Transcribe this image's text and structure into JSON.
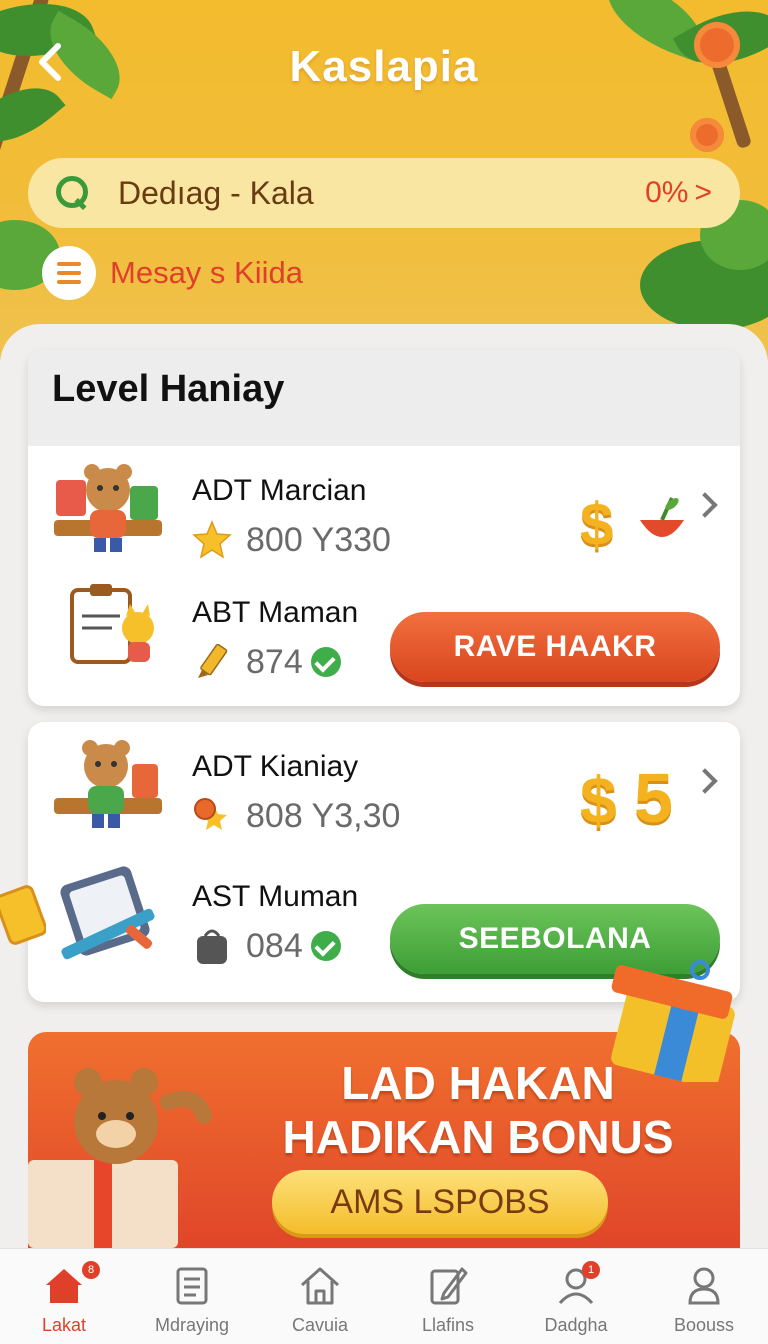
{
  "header": {
    "title": "Kaslapia",
    "back_icon": "chevron-left-icon"
  },
  "search": {
    "text": "Dedıag - Kala",
    "right_text": "0%",
    "right_chevron": ">"
  },
  "menu": {
    "label": "Mesay s Kiida"
  },
  "level_card": {
    "title": "Level Haniay",
    "items": [
      {
        "name": "ADT Marcian",
        "value": "800 Y330",
        "icon": "star-icon",
        "reward_symbol": "$"
      },
      {
        "name": "ABT Maman",
        "value": "874",
        "icon": "pencil-icon",
        "button": "RAVE HAAKR"
      }
    ]
  },
  "second_card": {
    "items": [
      {
        "name": "ADT Kianiay",
        "value": "808 Y3,30",
        "icon": "medal-icon",
        "reward_symbol": "$",
        "reward_value": "5"
      },
      {
        "name": "AST Muman",
        "value": "084",
        "icon": "bag-icon",
        "button": "SEEBOLANA"
      }
    ]
  },
  "bonus_banner": {
    "line1": "LAD HAKAN",
    "line2": "HADIKAN BONUS",
    "button": "AMS LSPOBS"
  },
  "nav": {
    "tabs": [
      {
        "label": "Lakat",
        "icon": "home-icon",
        "active": true,
        "badge": "8"
      },
      {
        "label": "Mdraying",
        "icon": "document-icon"
      },
      {
        "label": "Cavuia",
        "icon": "house-outline-icon"
      },
      {
        "label": "Llafins",
        "icon": "edit-icon"
      },
      {
        "label": "Dadgha",
        "icon": "user-icon",
        "badge": "1"
      },
      {
        "label": "Boouss",
        "icon": "profile-icon"
      }
    ]
  },
  "colors": {
    "header_yellow": "#f3bb2e",
    "accent_red": "#e0402a",
    "button_red": "#d9451e",
    "button_green": "#3d9e36"
  }
}
